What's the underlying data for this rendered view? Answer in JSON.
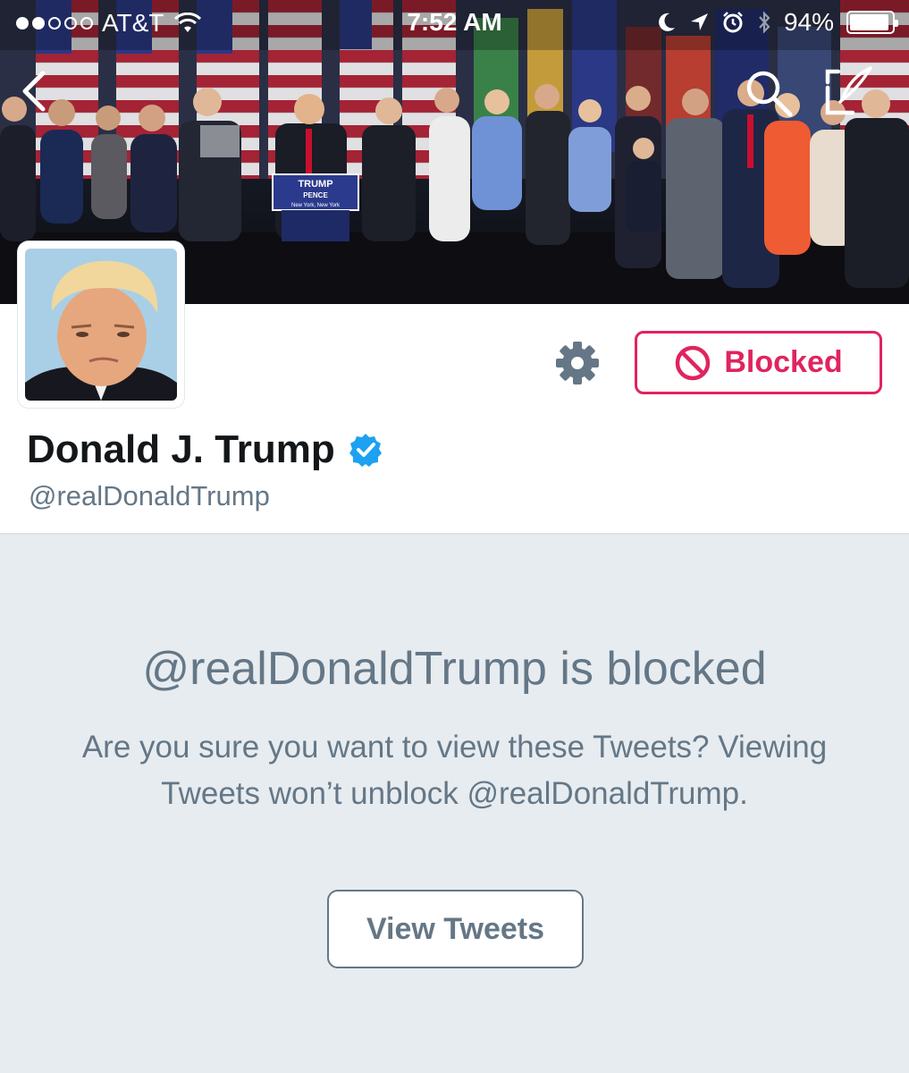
{
  "status_bar": {
    "signal_full": 2,
    "signal_total": 5,
    "carrier": "AT&T",
    "time": "7:52 AM",
    "battery": "94%",
    "battery_level": 0.94,
    "icons": [
      "wifi-icon",
      "moon-icon",
      "location-arrow-icon",
      "alarm-icon",
      "bluetooth-icon",
      "battery-icon"
    ]
  },
  "nav": {
    "back_icon": "chevron-left-icon",
    "search_icon": "search-icon",
    "compose_icon": "compose-icon"
  },
  "banner": {
    "podium_line1": "TRUMP",
    "podium_line2": "PENCE",
    "podium_line3": "New York, New York"
  },
  "profile": {
    "display_name": "Donald J. Trump",
    "handle": "@realDonaldTrump",
    "verified": true,
    "blocked_label": "Blocked",
    "settings_icon": "gear-icon"
  },
  "blocked": {
    "title": "@realDonaldTrump is blocked",
    "message": "Are you sure you want to view these Tweets? Viewing Tweets won’t unblock @realDonaldTrump.",
    "button_label": "View Tweets"
  },
  "colors": {
    "blocked_red": "#e0245e",
    "verified_blue": "#1da1f2",
    "muted_text": "#657786",
    "panel_bg": "#e6ecf0"
  }
}
